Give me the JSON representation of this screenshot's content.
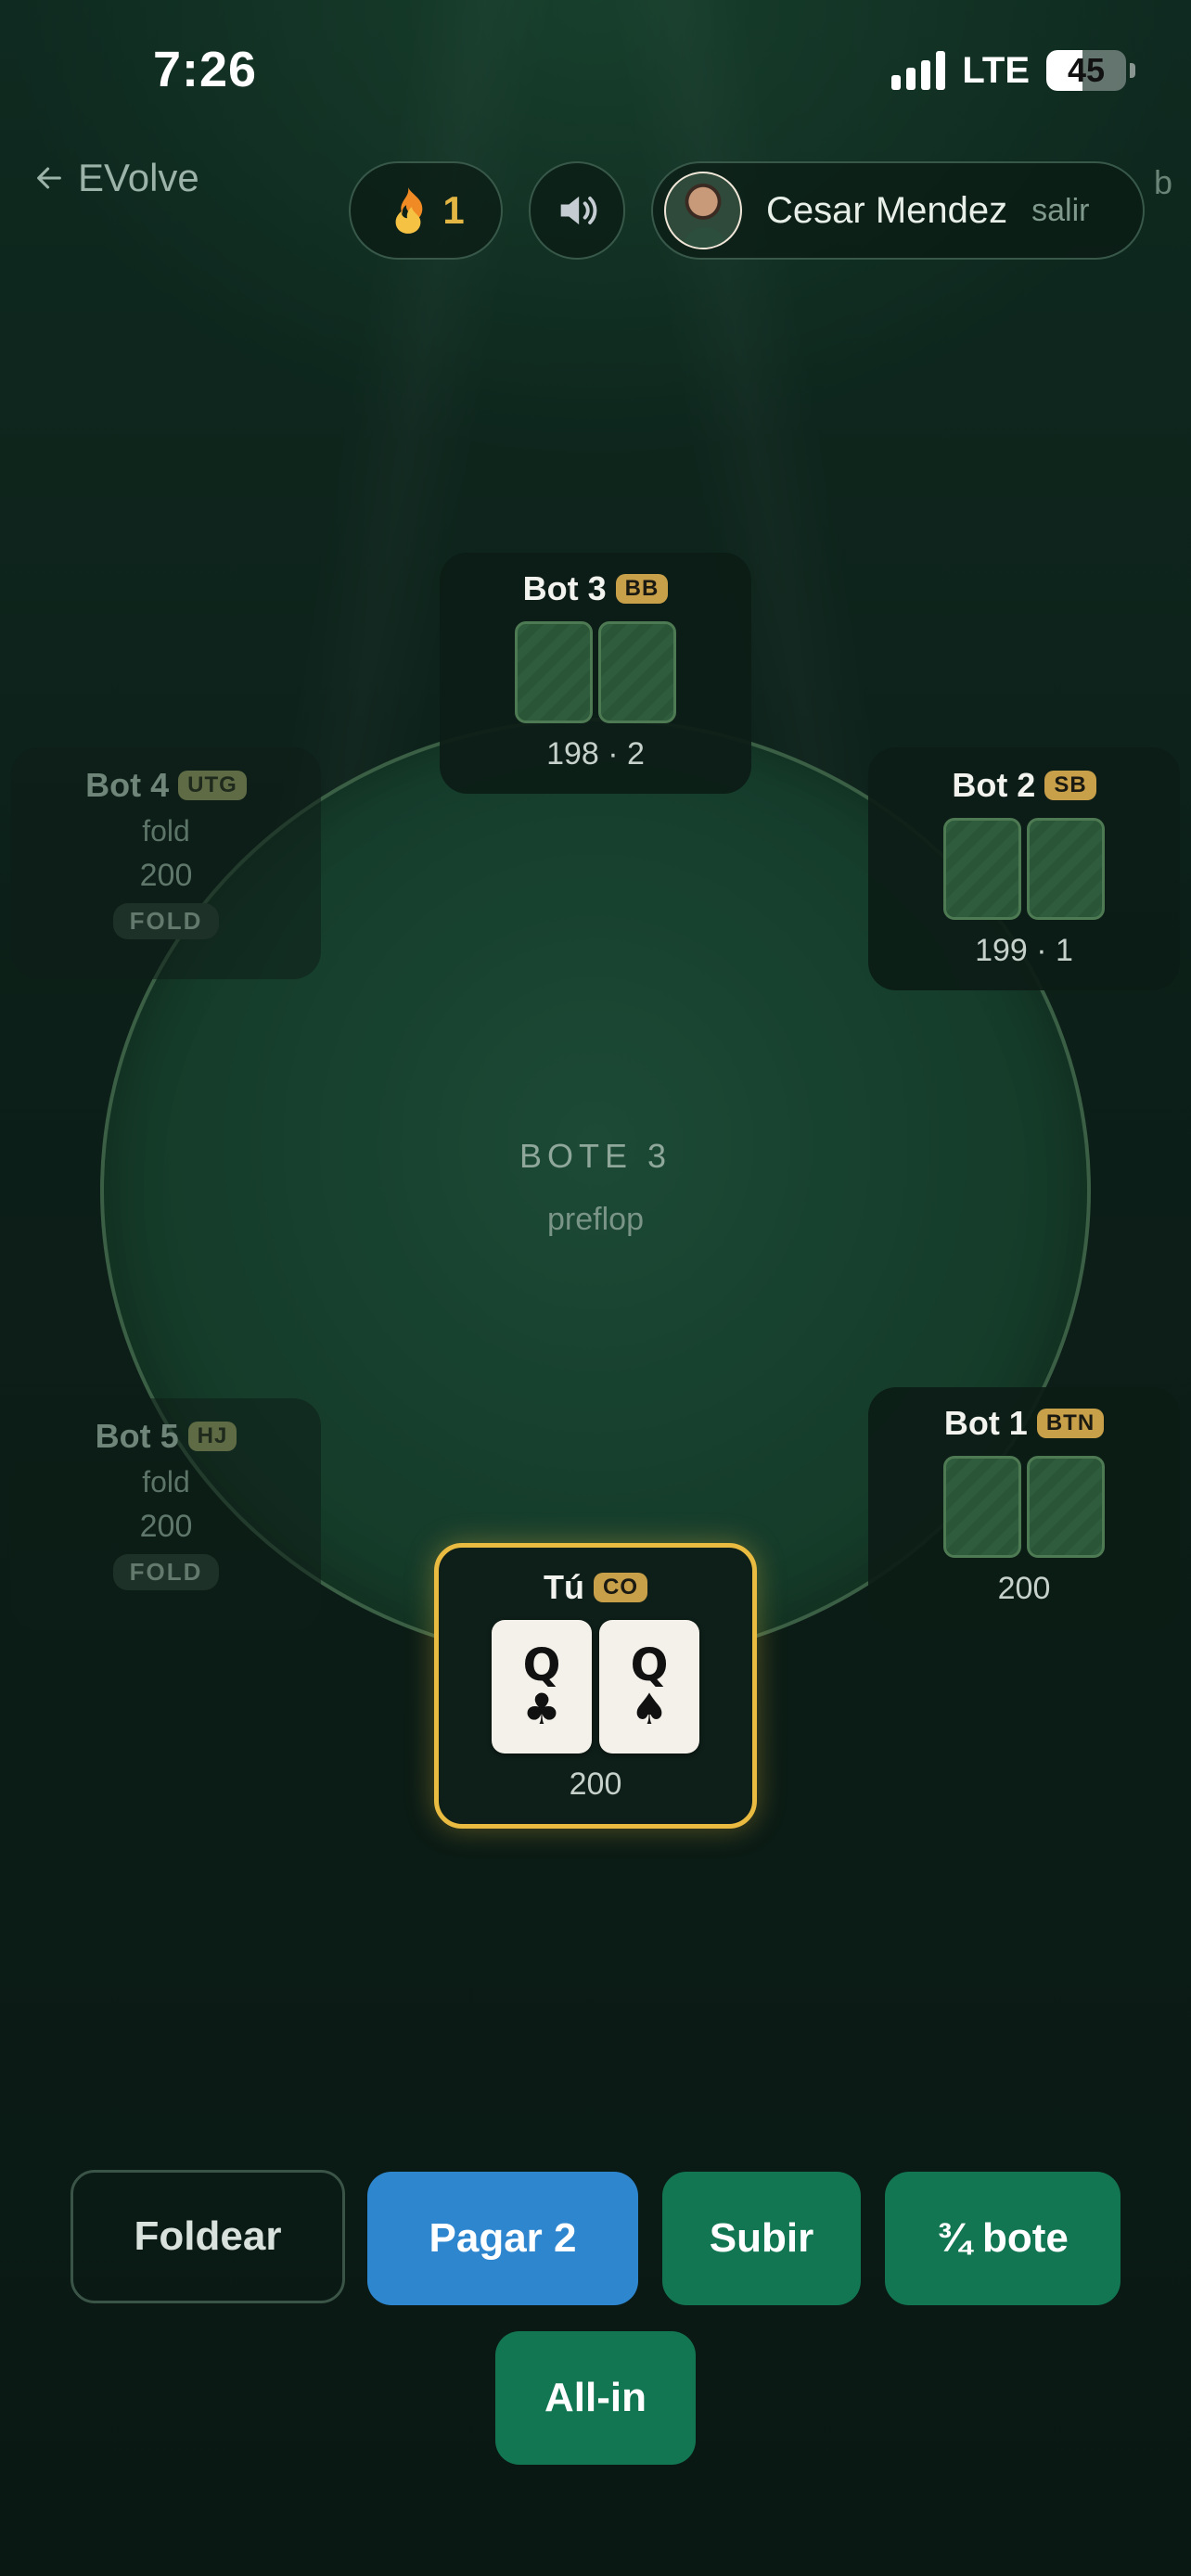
{
  "status_bar": {
    "time": "7:26",
    "network": "LTE",
    "battery": "45",
    "battery_level": 0.45
  },
  "header": {
    "back_label": "EVolve",
    "streak_count": "1",
    "user_name": "Cesar Mendez",
    "logout_label": "salir",
    "clipped_text": "b"
  },
  "table": {
    "pot_label": "BOTE 3",
    "street": "preflop"
  },
  "seats": {
    "bot3": {
      "name": "Bot 3",
      "position": "BB",
      "stack": "198 · 2"
    },
    "bot2": {
      "name": "Bot 2",
      "position": "SB",
      "stack": "199 · 1"
    },
    "bot1": {
      "name": "Bot 1",
      "position": "BTN",
      "stack": "200"
    },
    "bot4": {
      "name": "Bot 4",
      "position": "UTG",
      "status": "fold",
      "stack": "200",
      "tag": "FOLD"
    },
    "bot5": {
      "name": "Bot 5",
      "position": "HJ",
      "status": "fold",
      "stack": "200",
      "tag": "FOLD"
    },
    "me": {
      "name": "Tú",
      "position": "CO",
      "stack": "200",
      "cards": [
        {
          "rank": "Q",
          "suit": "♣"
        },
        {
          "rank": "Q",
          "suit": "♠"
        }
      ]
    }
  },
  "actions": {
    "fold": "Foldear",
    "call": "Pagar 2",
    "raise": "Subir",
    "three_quarter_pot": "¾ bote",
    "all_in": "All-in"
  },
  "colors": {
    "accent_gold": "#e9bb40",
    "call_blue": "#2e86cf",
    "action_green": "#127652",
    "background": "#0b1a15"
  }
}
